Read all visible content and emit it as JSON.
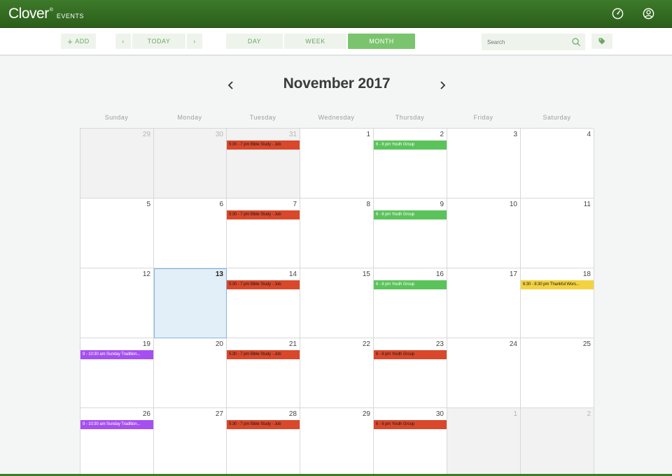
{
  "header": {
    "logo": "Clover",
    "logo_mark": "®",
    "subtitle": "EVENTS",
    "icons": [
      "dashboard-icon",
      "user-icon"
    ]
  },
  "toolbar": {
    "add_label": "ADD",
    "today_label": "TODAY",
    "views": [
      "DAY",
      "WEEK",
      "MONTH"
    ],
    "active_view": "MONTH",
    "search_placeholder": "Search"
  },
  "calendar": {
    "month_title": "November 2017",
    "weekdays": [
      "Sunday",
      "Monday",
      "Tuesday",
      "Wednesday",
      "Thursday",
      "Friday",
      "Saturday"
    ],
    "weeks": [
      [
        {
          "day": "29",
          "other": true
        },
        {
          "day": "30",
          "other": true
        },
        {
          "day": "31",
          "other": true,
          "event": {
            "text": "5:30 - 7 pm Bible Study - Job",
            "color": "red"
          }
        },
        {
          "day": "1"
        },
        {
          "day": "2",
          "event": {
            "text": "6 - 8 pm Youth Group",
            "color": "green"
          }
        },
        {
          "day": "3"
        },
        {
          "day": "4"
        }
      ],
      [
        {
          "day": "5"
        },
        {
          "day": "6"
        },
        {
          "day": "7",
          "event": {
            "text": "5:30 - 7 pm Bible Study - Job",
            "color": "red"
          }
        },
        {
          "day": "8"
        },
        {
          "day": "9",
          "event": {
            "text": "6 - 8 pm Youth Group",
            "color": "green"
          }
        },
        {
          "day": "10"
        },
        {
          "day": "11"
        }
      ],
      [
        {
          "day": "12"
        },
        {
          "day": "13",
          "today": true
        },
        {
          "day": "14",
          "event": {
            "text": "5:30 - 7 pm Bible Study - Job",
            "color": "red"
          }
        },
        {
          "day": "15"
        },
        {
          "day": "16",
          "event": {
            "text": "6 - 8 pm Youth Group",
            "color": "green"
          }
        },
        {
          "day": "17"
        },
        {
          "day": "18",
          "event": {
            "text": "6:30 - 8:30 pm Thankful Wors...",
            "color": "yellow"
          }
        }
      ],
      [
        {
          "day": "19",
          "event": {
            "text": "9 - 10:30 am Sunday Tradition...",
            "color": "purple"
          }
        },
        {
          "day": "20"
        },
        {
          "day": "21",
          "event": {
            "text": "5:30 - 7 pm Bible Study - Job",
            "color": "red"
          }
        },
        {
          "day": "22"
        },
        {
          "day": "23",
          "event": {
            "text": "6 - 8 pm Youth Group",
            "color": "red"
          }
        },
        {
          "day": "24"
        },
        {
          "day": "25"
        }
      ],
      [
        {
          "day": "26",
          "event": {
            "text": "9 - 10:30 am Sunday Tradition...",
            "color": "purple"
          }
        },
        {
          "day": "27"
        },
        {
          "day": "28",
          "event": {
            "text": "5:30 - 7 pm Bible Study - Job",
            "color": "red"
          }
        },
        {
          "day": "29"
        },
        {
          "day": "30",
          "event": {
            "text": "6 - 8 pm Youth Group",
            "color": "red"
          }
        },
        {
          "day": "1",
          "other": true
        },
        {
          "day": "2",
          "other": true
        }
      ]
    ]
  },
  "colors": {
    "header_green": "#2b5e1a",
    "accent_green": "#7bc46e",
    "event_red": "#d9482b",
    "event_green": "#5ac35a",
    "event_purple": "#a64ff0",
    "event_yellow": "#f3d240",
    "today_bg": "#e2eef8"
  }
}
